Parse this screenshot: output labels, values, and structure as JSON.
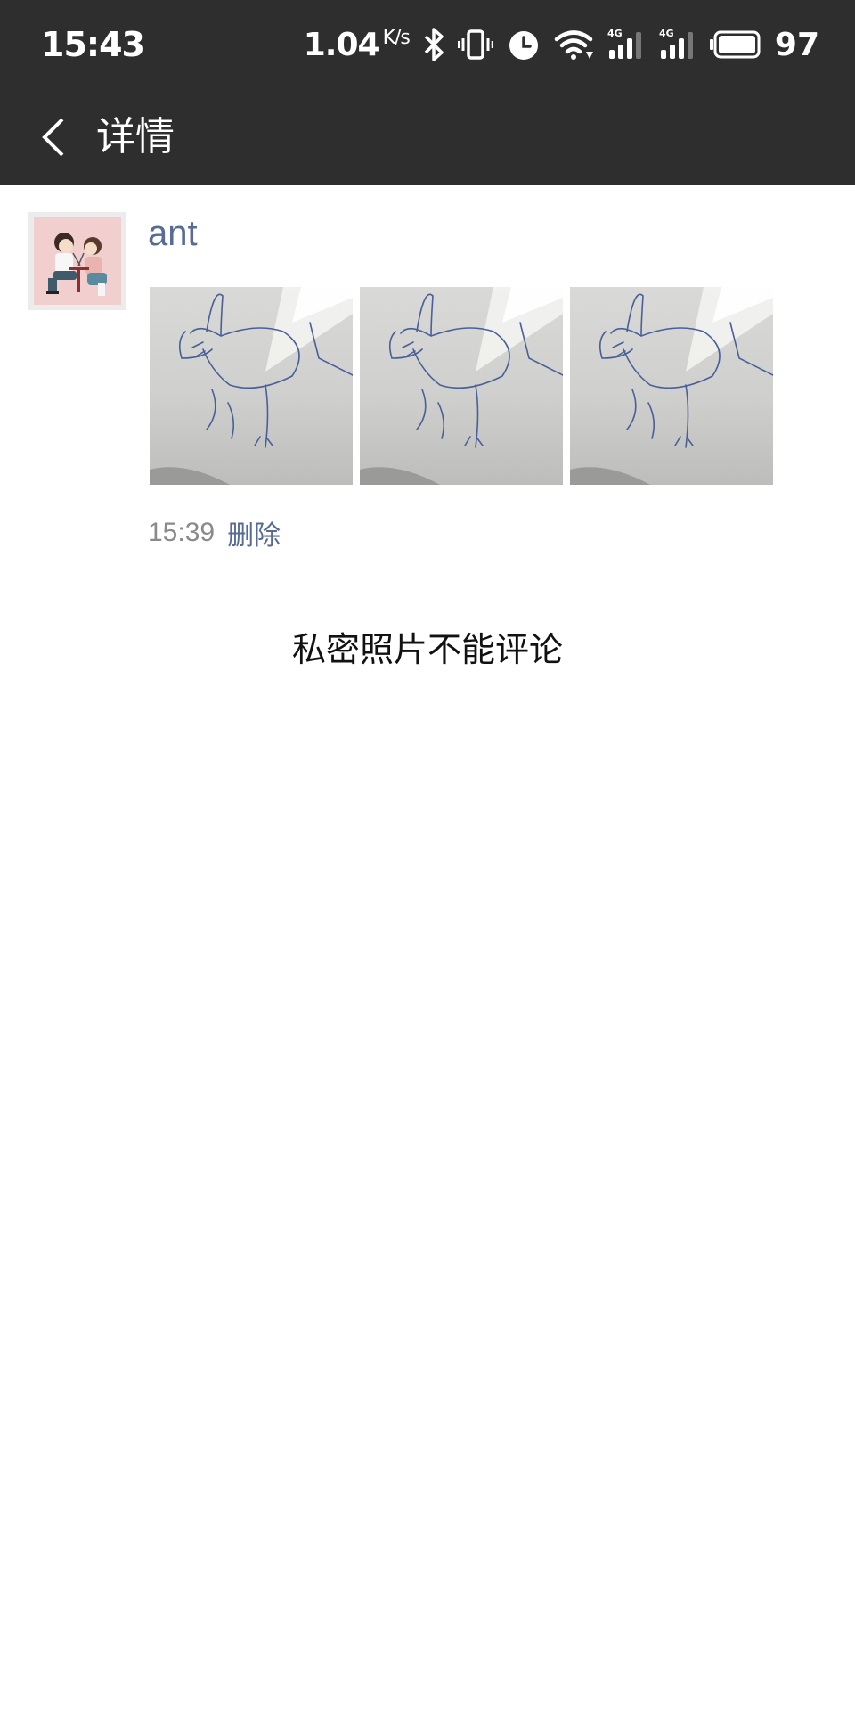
{
  "status_bar": {
    "time": "15:43",
    "net_speed": "1.04",
    "net_unit": "K/s",
    "battery": "97",
    "icons": [
      "bluetooth-icon",
      "vibrate-icon",
      "alarm-icon",
      "wifi-icon",
      "signal-4g-icon",
      "signal-4g-icon",
      "battery-icon"
    ],
    "network_label": "4G"
  },
  "nav": {
    "title": "详情",
    "back_icon": "chevron-left-icon"
  },
  "post": {
    "author": "ant",
    "photos": [
      "photo-1",
      "photo-2",
      "photo-3"
    ],
    "time": "15:39",
    "delete_label": "删除"
  },
  "notice": "私密照片不能评论",
  "colors": {
    "bar_background": "#2e2e2e",
    "link": "#576b95",
    "meta_gray": "#8a8a8a"
  }
}
